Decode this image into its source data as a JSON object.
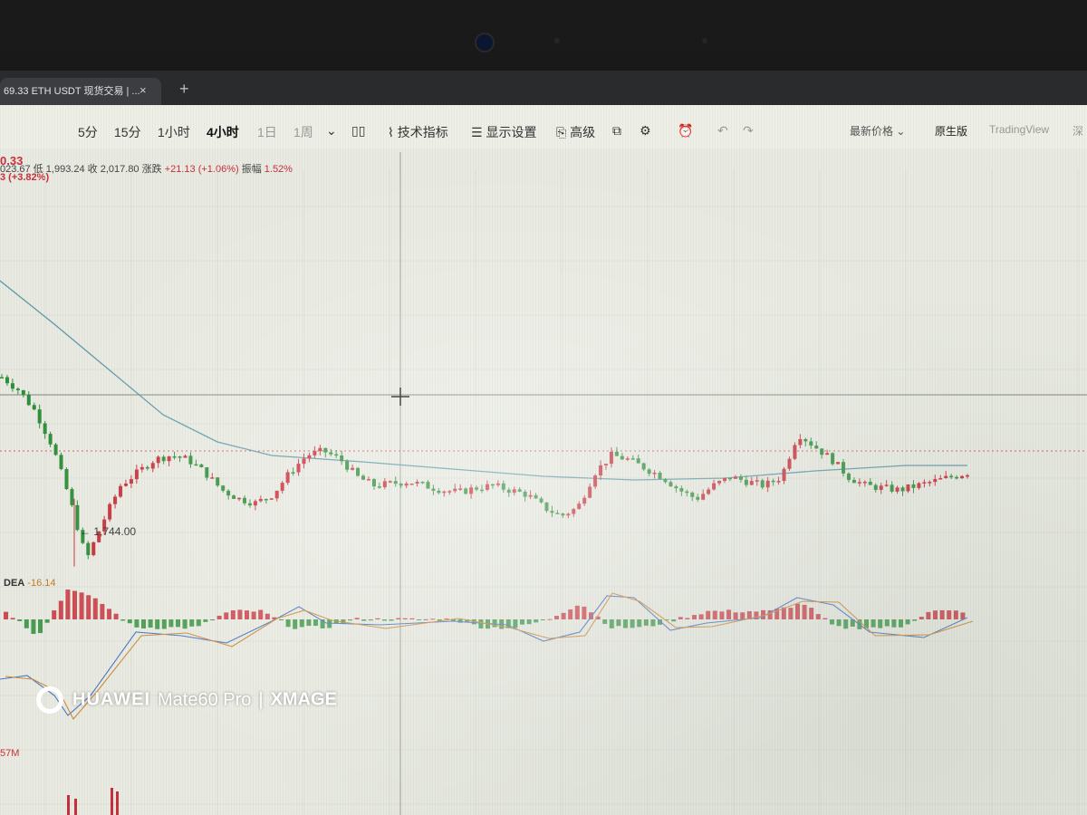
{
  "browser": {
    "tab_title": "69.33 ETH USDT 现货交易 | ...",
    "tab_close": "×",
    "new_tab": "+"
  },
  "toolbar": {
    "intervals": [
      "5分",
      "15分",
      "1小时",
      "4小时",
      "1日",
      "1周"
    ],
    "active_interval": "4小时",
    "more_caret": "⌄",
    "chart_type_icon": "candlestick-icon",
    "indicators_label": "技术指标",
    "display_settings_label": "显示设置",
    "advanced_label": "高级",
    "latest_price_label": "最新价格",
    "original_label": "原生版",
    "tradingview_label": "TradingView",
    "depth_label": "深"
  },
  "ticker": {
    "price": "0.33",
    "change": "3 (+3.82%)"
  },
  "ohlc": {
    "high_value": "023.67",
    "low_label": "低",
    "low_value": "1,993.24",
    "close_label": "收",
    "close_value": "2,017.80",
    "change_label": "涨跌",
    "change_value": "+21.13 (+1.06%)",
    "amplitude_label": "振幅",
    "amplitude_value": "1.52%"
  },
  "annotations": {
    "low_marker": "← 1,744.00"
  },
  "macd": {
    "dea_label": "DEA",
    "dea_value": "-16.14"
  },
  "volume": {
    "label": "57M"
  },
  "watermark": {
    "brand": "HUAWEI",
    "model": "Mate60 Pro",
    "separator": "|",
    "xmage": "XMAGE"
  },
  "colors": {
    "up": "#c9303b",
    "down": "#2f8f3a",
    "ma": "#5d9aa8",
    "dif": "#4a78c4",
    "dea": "#d08a3a",
    "grid": "#d6dacd"
  },
  "chart_data": [
    {
      "type": "candlestick",
      "description_units": "ETH/USDT price, 4h candles",
      "close_trend": [
        2180,
        2150,
        2100,
        2020,
        1900,
        1760,
        1850,
        1930,
        1960,
        1990,
        2000,
        1990,
        1960,
        1920,
        1900,
        1890,
        1910,
        1960,
        2000,
        2010,
        1990,
        1950,
        1930,
        1935,
        1940,
        1930,
        1920,
        1915,
        1925,
        1930,
        1920,
        1910,
        1880,
        1860,
        1880,
        1960,
        2000,
        1990,
        1970,
        1950,
        1920,
        1900,
        1930,
        1950,
        1940,
        1930,
        1950,
        2050,
        2020,
        1990,
        1950,
        1930,
        1925,
        1920,
        1930,
        1940,
        1950,
        1960
      ],
      "annotated_low": 1744.0,
      "moving_average": "descending then flat"
    },
    {
      "type": "bar",
      "name": "MACD",
      "histogram_trend": [
        1,
        -2,
        4,
        2,
        -1,
        -1,
        -1,
        1,
        1,
        -1,
        -1,
        0,
        0,
        0,
        0,
        -1,
        -1,
        0,
        2,
        -1,
        -1,
        0,
        1,
        1,
        1,
        2,
        -1,
        -1,
        -1,
        1,
        1
      ],
      "dea": -16.14
    }
  ]
}
